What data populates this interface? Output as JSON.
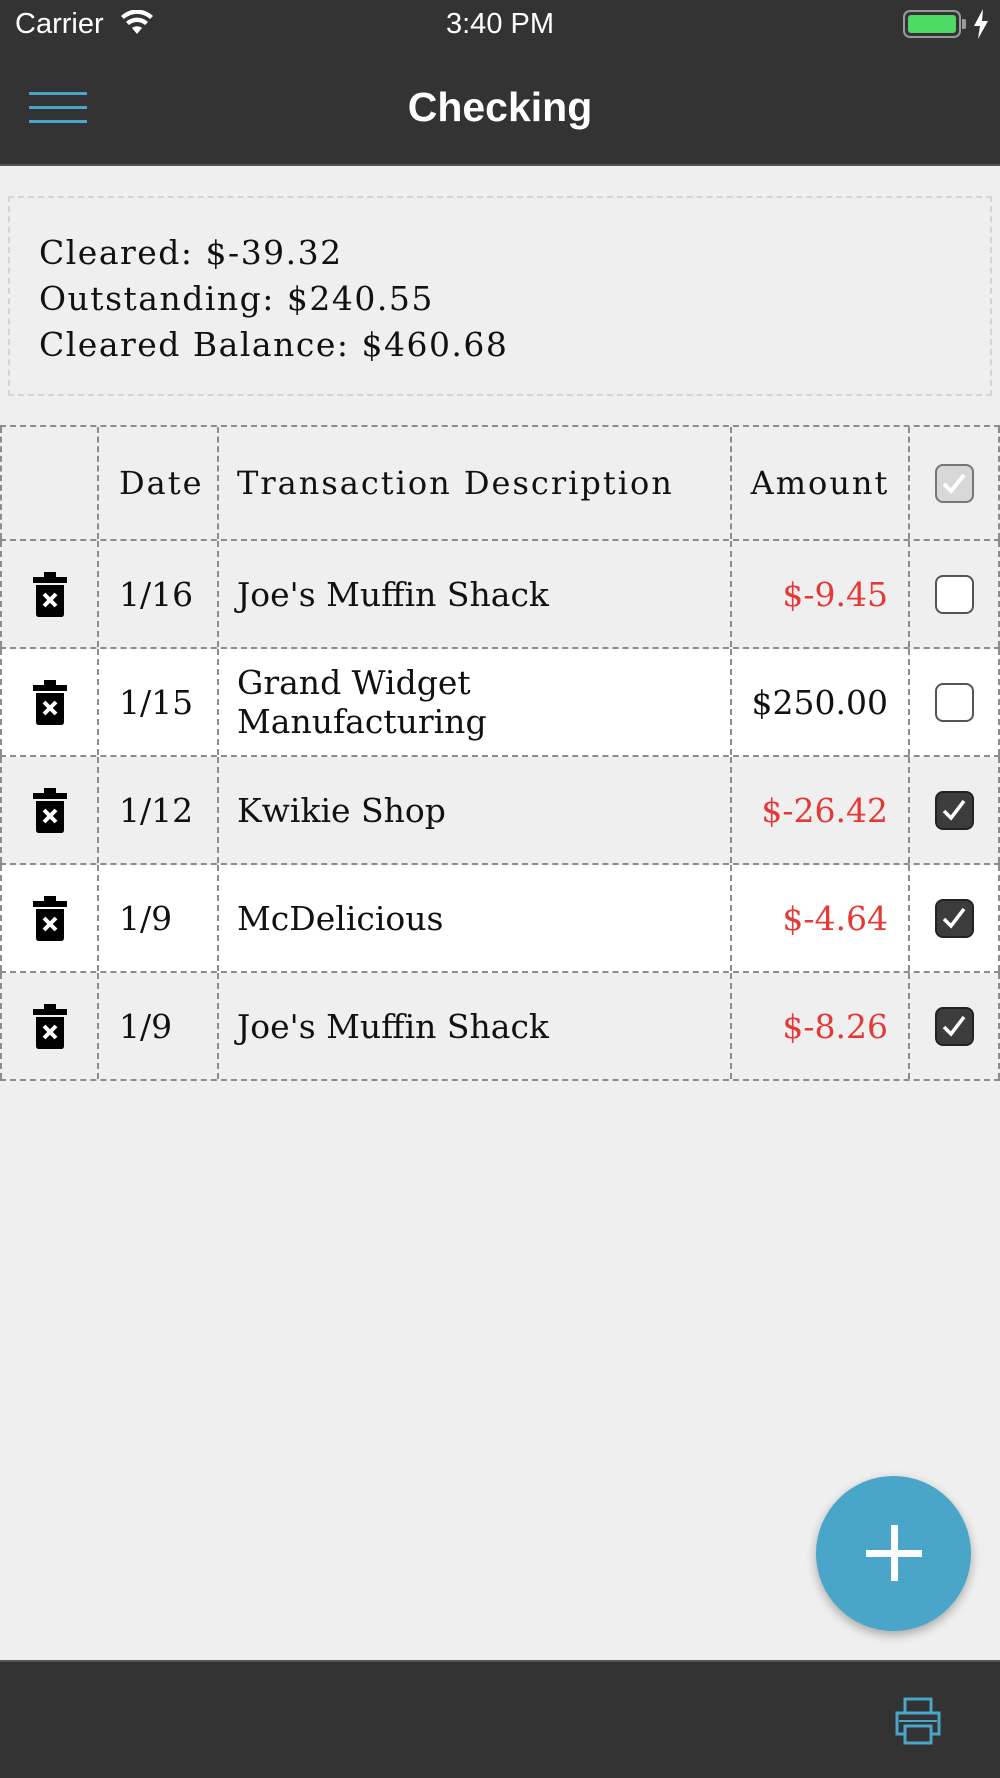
{
  "status_bar": {
    "carrier": "Carrier",
    "time": "3:40 PM",
    "battery_color": "#4cd964"
  },
  "nav": {
    "title": "Checking",
    "menu_icon": "hamburger-menu-icon",
    "accent_color": "#4aa6c8"
  },
  "summary": {
    "cleared": "Cleared: $-39.32",
    "outstanding": "Outstanding: $240.55",
    "cleared_balance": "Cleared Balance: $460.68"
  },
  "table": {
    "headers": {
      "date": "Date",
      "description": "Transaction Description",
      "amount": "Amount",
      "select_all_checked": true
    },
    "rows": [
      {
        "date": "1/16",
        "description": "Joe's Muffin Shack",
        "amount": "$-9.45",
        "negative": true,
        "cleared": false
      },
      {
        "date": "1/15",
        "description": "Grand Widget Manufacturing",
        "amount": "$250.00",
        "negative": false,
        "cleared": false
      },
      {
        "date": "1/12",
        "description": "Kwikie Shop",
        "amount": "$-26.42",
        "negative": true,
        "cleared": true
      },
      {
        "date": "1/9",
        "description": "McDelicious",
        "amount": "$-4.64",
        "negative": true,
        "cleared": true
      },
      {
        "date": "1/9",
        "description": "Joe's Muffin Shack",
        "amount": "$-8.26",
        "negative": true,
        "cleared": true
      }
    ]
  },
  "fab": {
    "icon": "plus-icon",
    "color": "#4aa6c8"
  },
  "bottom_bar": {
    "icon": "printer-icon"
  },
  "colors": {
    "negative_amount": "#e53935",
    "bar_background": "#333333",
    "page_background": "#efefef"
  }
}
